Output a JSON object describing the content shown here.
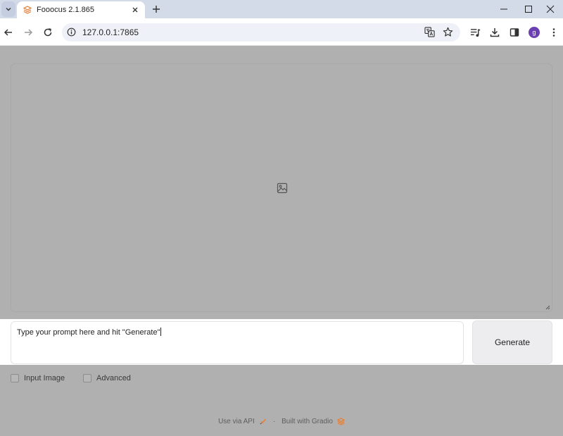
{
  "browser": {
    "tab_title": "Fooocus 2.1.865",
    "url": "127.0.0.1:7865",
    "profile_initial": "g",
    "icons": [
      "tab-list-icon",
      "fooocus-favicon",
      "close-icon",
      "new-tab-icon",
      "minimize-icon",
      "maximize-icon",
      "window-close-icon",
      "back-icon",
      "forward-icon",
      "reload-icon",
      "site-info-icon",
      "translate-icon",
      "bookmark-star-icon",
      "media-control-icon",
      "download-icon",
      "side-panel-icon",
      "menu-icon"
    ]
  },
  "main": {
    "gallery_icon": "image-icon",
    "prompt_value": "Type your prompt here and hit \"Generate\"",
    "generate_label": "Generate",
    "checkboxes": [
      {
        "label": "Input Image",
        "checked": false
      },
      {
        "label": "Advanced",
        "checked": false
      }
    ]
  },
  "footer": {
    "api_label": "Use via API",
    "separator": "·",
    "built_label": "Built with Gradio"
  },
  "colors": {
    "overlay_gray": "#b0b0b0",
    "gradio_orange": "#f97316",
    "avatar_purple": "#6a3fb1"
  }
}
